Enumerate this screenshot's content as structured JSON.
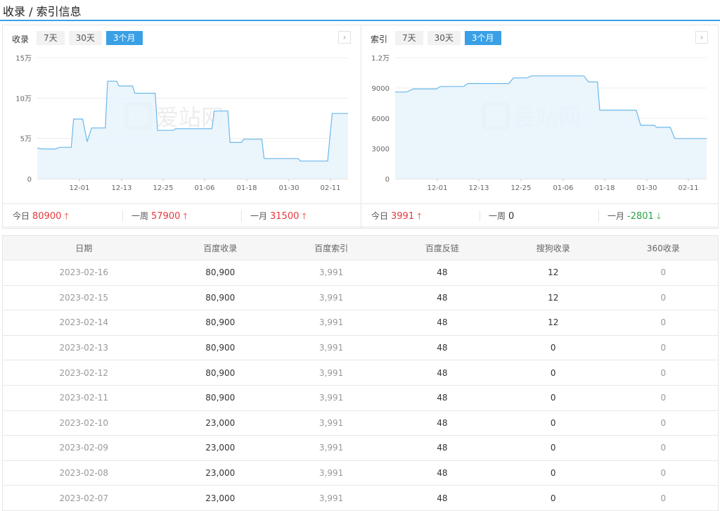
{
  "header": {
    "title": "收录 / 索引信息"
  },
  "left_panel": {
    "label": "收录",
    "tabs": [
      {
        "label": "7天",
        "active": false
      },
      {
        "label": "30天",
        "active": false
      },
      {
        "label": "3个月",
        "active": true
      }
    ],
    "stats": [
      {
        "label": "今日",
        "value": "80900",
        "trend": "up"
      },
      {
        "label": "一周",
        "value": "57900",
        "trend": "up"
      },
      {
        "label": "一月",
        "value": "31500",
        "trend": "up"
      }
    ]
  },
  "right_panel": {
    "label": "索引",
    "tabs": [
      {
        "label": "7天",
        "active": false
      },
      {
        "label": "30天",
        "active": false
      },
      {
        "label": "3个月",
        "active": true
      }
    ],
    "stats": [
      {
        "label": "今日",
        "value": "3991",
        "trend": "up"
      },
      {
        "label": "一周",
        "value": "0",
        "trend": "none"
      },
      {
        "label": "一月",
        "value": "-2801",
        "trend": "down"
      }
    ]
  },
  "watermark": "爱站网",
  "next_icon": "chevron-right-icon",
  "colors": {
    "accent": "#3aa0e6",
    "line": "#6bb8ea",
    "area": "#e8f3fc",
    "up": "#e4393c",
    "down": "#2ba245"
  },
  "chart_data": [
    {
      "type": "area",
      "x_ticks": [
        "12-01",
        "12-13",
        "12-25",
        "01-06",
        "01-18",
        "01-30",
        "02-11"
      ],
      "y_ticks": [
        "0",
        "5万",
        "10万",
        "15万"
      ],
      "ylim": [
        0,
        150000
      ],
      "series": [
        {
          "values": [
            [
              0,
              38000
            ],
            [
              2,
              37000
            ],
            [
              8,
              37000
            ],
            [
              10,
              39000
            ],
            [
              15,
              39000
            ],
            [
              16,
              74000
            ],
            [
              20,
              74000
            ],
            [
              22,
              46000
            ],
            [
              23,
              55000
            ],
            [
              24,
              63000
            ],
            [
              30,
              63000
            ],
            [
              31,
              121000
            ],
            [
              35,
              121000
            ],
            [
              36,
              115000
            ],
            [
              42,
              115000
            ],
            [
              43,
              106000
            ],
            [
              52,
              106000
            ],
            [
              53,
              60000
            ],
            [
              60,
              60000
            ],
            [
              61,
              62000
            ],
            [
              77,
              62000
            ],
            [
              78,
              84000
            ],
            [
              84,
              84000
            ],
            [
              85,
              45000
            ],
            [
              90,
              45000
            ],
            [
              91,
              49000
            ],
            [
              99,
              49000
            ],
            [
              100,
              25000
            ],
            [
              115,
              25000
            ],
            [
              116,
              22000
            ],
            [
              128,
              22000
            ],
            [
              130,
              80900
            ],
            [
              137,
              80900
            ]
          ]
        }
      ],
      "grid": true
    },
    {
      "type": "area",
      "x_ticks": [
        "12-01",
        "12-13",
        "12-25",
        "01-06",
        "01-18",
        "01-30",
        "02-11"
      ],
      "y_ticks": [
        "0",
        "3000",
        "6000",
        "9000",
        "1.2万"
      ],
      "ylim": [
        0,
        12000
      ],
      "series": [
        {
          "values": [
            [
              0,
              8600
            ],
            [
              5,
              8600
            ],
            [
              8,
              8900
            ],
            [
              18,
              8900
            ],
            [
              20,
              9150
            ],
            [
              30,
              9150
            ],
            [
              32,
              9450
            ],
            [
              50,
              9450
            ],
            [
              52,
              10000
            ],
            [
              58,
              10000
            ],
            [
              60,
              10200
            ],
            [
              83,
              10200
            ],
            [
              85,
              9600
            ],
            [
              89,
              9600
            ],
            [
              90,
              6800
            ],
            [
              106,
              6800
            ],
            [
              108,
              5300
            ],
            [
              114,
              5300
            ],
            [
              115,
              5100
            ],
            [
              121,
              5100
            ],
            [
              123,
              3991
            ],
            [
              137,
              3991
            ]
          ]
        }
      ],
      "grid": true
    }
  ],
  "table": {
    "columns": [
      "日期",
      "百度收录",
      "百度索引",
      "百度反链",
      "搜狗收录",
      "360收录"
    ],
    "rows": [
      [
        "2023-02-16",
        "80,900",
        "3,991",
        "48",
        "12",
        "0"
      ],
      [
        "2023-02-15",
        "80,900",
        "3,991",
        "48",
        "12",
        "0"
      ],
      [
        "2023-02-14",
        "80,900",
        "3,991",
        "48",
        "12",
        "0"
      ],
      [
        "2023-02-13",
        "80,900",
        "3,991",
        "48",
        "0",
        "0"
      ],
      [
        "2023-02-12",
        "80,900",
        "3,991",
        "48",
        "0",
        "0"
      ],
      [
        "2023-02-11",
        "80,900",
        "3,991",
        "48",
        "0",
        "0"
      ],
      [
        "2023-02-10",
        "23,000",
        "3,991",
        "48",
        "0",
        "0"
      ],
      [
        "2023-02-09",
        "23,000",
        "3,991",
        "48",
        "0",
        "0"
      ],
      [
        "2023-02-08",
        "23,000",
        "3,991",
        "48",
        "0",
        "0"
      ],
      [
        "2023-02-07",
        "23,000",
        "3,991",
        "48",
        "0",
        "0"
      ]
    ]
  }
}
